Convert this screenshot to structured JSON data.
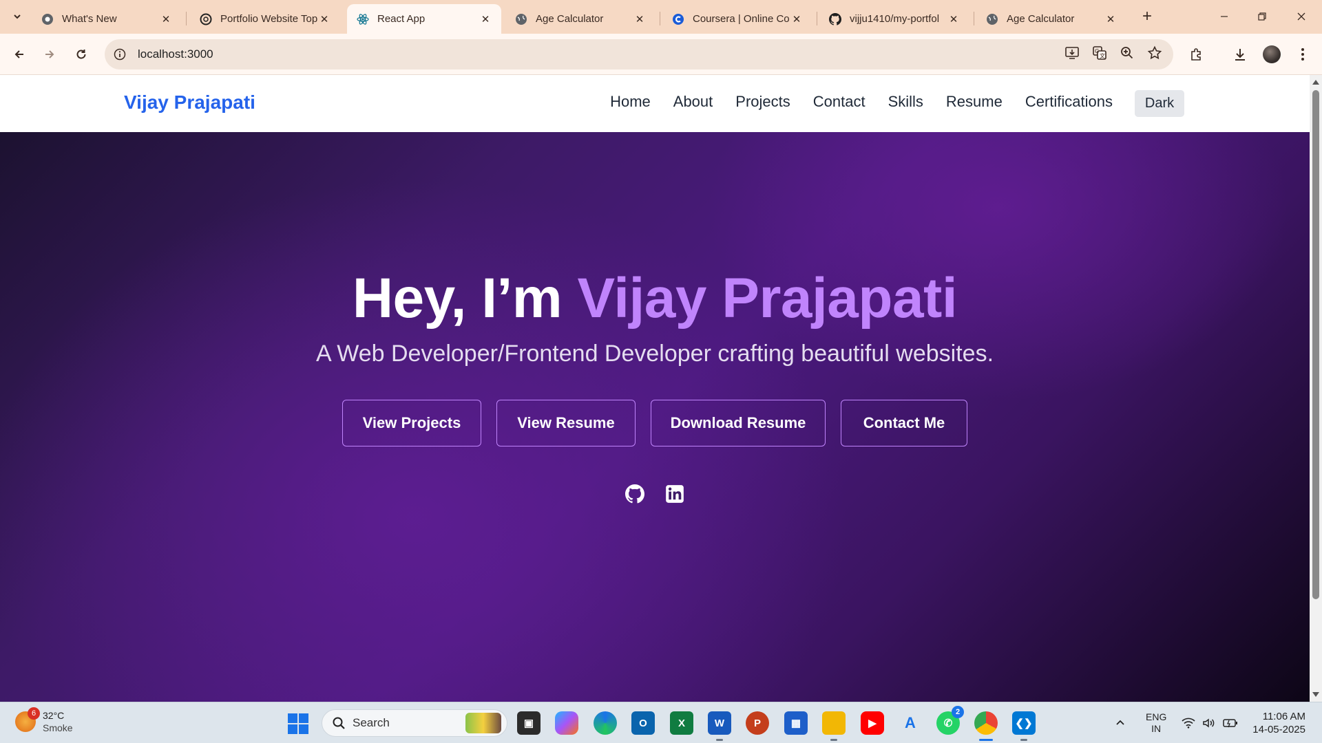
{
  "browser": {
    "tabs": [
      {
        "title": "What's New",
        "icon": "chrome-icon",
        "active": false
      },
      {
        "title": "Portfolio Website Top",
        "icon": "openai-icon",
        "active": false
      },
      {
        "title": "React App",
        "icon": "react-icon",
        "active": true
      },
      {
        "title": "Age Calculator",
        "icon": "globe-icon",
        "active": false
      },
      {
        "title": "Coursera | Online Co",
        "icon": "coursera-icon",
        "active": false
      },
      {
        "title": "vijju1410/my-portfol",
        "icon": "github-icon",
        "active": false
      },
      {
        "title": "Age Calculator",
        "icon": "globe-icon",
        "active": false
      }
    ],
    "url": "localhost:3000"
  },
  "site": {
    "brand": "Vijay Prajapati",
    "nav": [
      "Home",
      "About",
      "Projects",
      "Contact",
      "Skills",
      "Resume",
      "Certifications"
    ],
    "theme_toggle": "Dark",
    "hero": {
      "greeting": "Hey, I’m ",
      "name": "Vijay Prajapati",
      "tagline": "A Web Developer/Frontend Developer crafting beautiful websites.",
      "buttons": [
        "View Projects",
        "View Resume",
        "Download Resume",
        "Contact Me"
      ],
      "socials": [
        "github-icon",
        "linkedin-icon"
      ]
    },
    "colors": {
      "brand": "#2563eb",
      "accent": "#c084fc"
    }
  },
  "taskbar": {
    "weather": {
      "temp": "32°C",
      "condition": "Smoke",
      "badge": "6"
    },
    "search_label": "Search",
    "apps": [
      "file-explorer-icon",
      "copilot-icon",
      "edge-icon",
      "outlook-icon",
      "excel-icon",
      "word-icon",
      "powerpoint-icon",
      "store-icon",
      "folder-icon",
      "youtube-icon",
      "app-icon",
      "whatsapp-icon",
      "chrome-icon",
      "vscode-icon"
    ],
    "whatsapp_count": "2",
    "language": {
      "line1": "ENG",
      "line2": "IN"
    },
    "time": "11:06 AM",
    "date": "14-05-2025"
  }
}
